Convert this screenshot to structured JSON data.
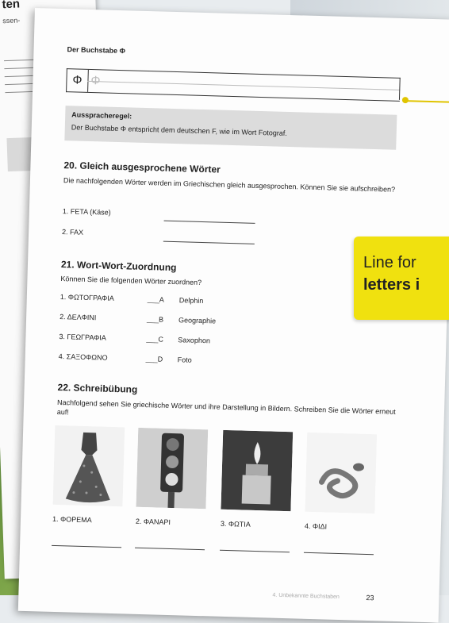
{
  "back_page": {
    "title": "ten",
    "text": "ssen-"
  },
  "page": {
    "letter_heading": "Der Buchstabe Φ",
    "letter": "Φ",
    "letter_trace": "Φ",
    "rule": {
      "title": "Ausspracheregel:",
      "text": "Der Buchstabe Φ entspricht dem deutschen F, wie im Wort Fotograf."
    },
    "section20": {
      "title": "20. Gleich ausgesprochene Wörter",
      "intro": "Die nachfolgenden Wörter werden im Griechischen gleich ausgesprochen. Können Sie sie aufschreiben?",
      "items": [
        "1.  FETA (Käse)",
        "2.  FAX"
      ]
    },
    "section21": {
      "title": "21. Wort-Wort-Zuordnung",
      "intro": "Können Sie die folgenden Wörter zuordnen?",
      "left": [
        "1.  ΦΩΤΟΓΡΑΦΙΑ",
        "2.  ΔΕΛΦΙΝΙ",
        "3.  ΓΕΩΓΡΑΦΙΑ",
        "4.  ΣΑΞΟΦΩΝΟ"
      ],
      "letters": [
        "___A",
        "___B",
        "___C",
        "___D"
      ],
      "right": [
        "Delphin",
        "Geographie",
        "Saxophon",
        "Foto"
      ]
    },
    "section22": {
      "title": "22. Schreibübung",
      "intro": "Nachfolgend sehen Sie griechische Wörter und ihre Darstellung in Bildern. Schreiben Sie die Wörter erneut auf!",
      "captions": [
        "1. ΦΟΡΕΜΑ",
        "2. ΦΑΝΑΡΙ",
        "3. ΦΩΤΙΑ",
        "4. ΦΙΔΙ"
      ],
      "image_icons": [
        "dress-icon",
        "traffic-light-icon",
        "lighter-flame-icon",
        "snake-icon"
      ]
    },
    "footer": {
      "chapter": "4. Unbekannte Buchstaben",
      "page_number": "23"
    }
  },
  "callout": {
    "line1": "Line for",
    "line2": "letters i"
  },
  "colors": {
    "callout_yellow": "#f0e10f",
    "rule_grey": "#dcdcdc",
    "background_green": "#6f9a43"
  }
}
